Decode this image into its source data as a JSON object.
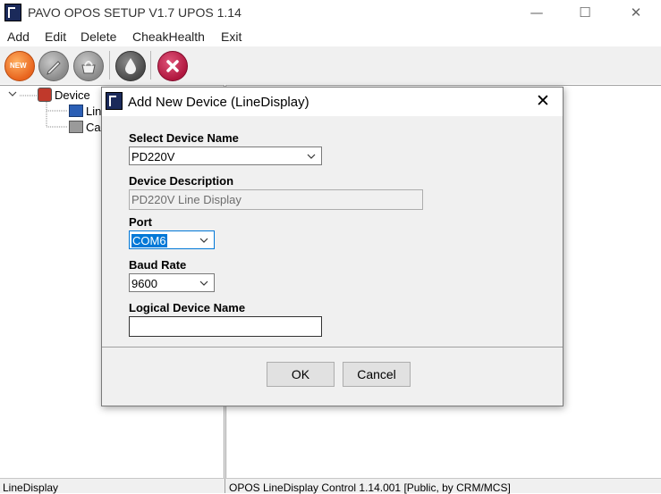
{
  "window": {
    "title": "PAVO OPOS SETUP V1.7 UPOS 1.14",
    "minimize_glyph": "—",
    "maximize_glyph": "☐",
    "close_glyph": "✕"
  },
  "menu": {
    "items": [
      "Add",
      "Edit",
      "Delete",
      "CheakHealth",
      "Exit"
    ]
  },
  "toolbar": {
    "new_label": "NEW",
    "icons": [
      "new-icon",
      "edit-pencil-icon",
      "delete-basket-icon",
      "health-drop-icon",
      "exit-x-icon"
    ],
    "colors": {
      "new": "#e8641e",
      "gray": "#8a8a8a",
      "dark": "#4a4a4a",
      "exit": "#b0173f"
    }
  },
  "tree": {
    "root": "Device",
    "children": [
      "Lin",
      "Ca"
    ]
  },
  "status": {
    "left": "LineDisplay",
    "right": "OPOS LineDisplay Control 1.14.001 [Public, by CRM/MCS]"
  },
  "dialog": {
    "title": "Add New Device (LineDisplay)",
    "close_glyph": "✕",
    "select_device_label": "Select Device Name",
    "select_device_value": "PD220V",
    "description_label": "Device Description",
    "description_value": "PD220V Line Display",
    "port_label": "Port",
    "port_value": "COM6",
    "baud_label": "Baud Rate",
    "baud_value": "9600",
    "logical_label": "Logical Device Name",
    "logical_value": "",
    "ok_label": "OK",
    "cancel_label": "Cancel"
  }
}
